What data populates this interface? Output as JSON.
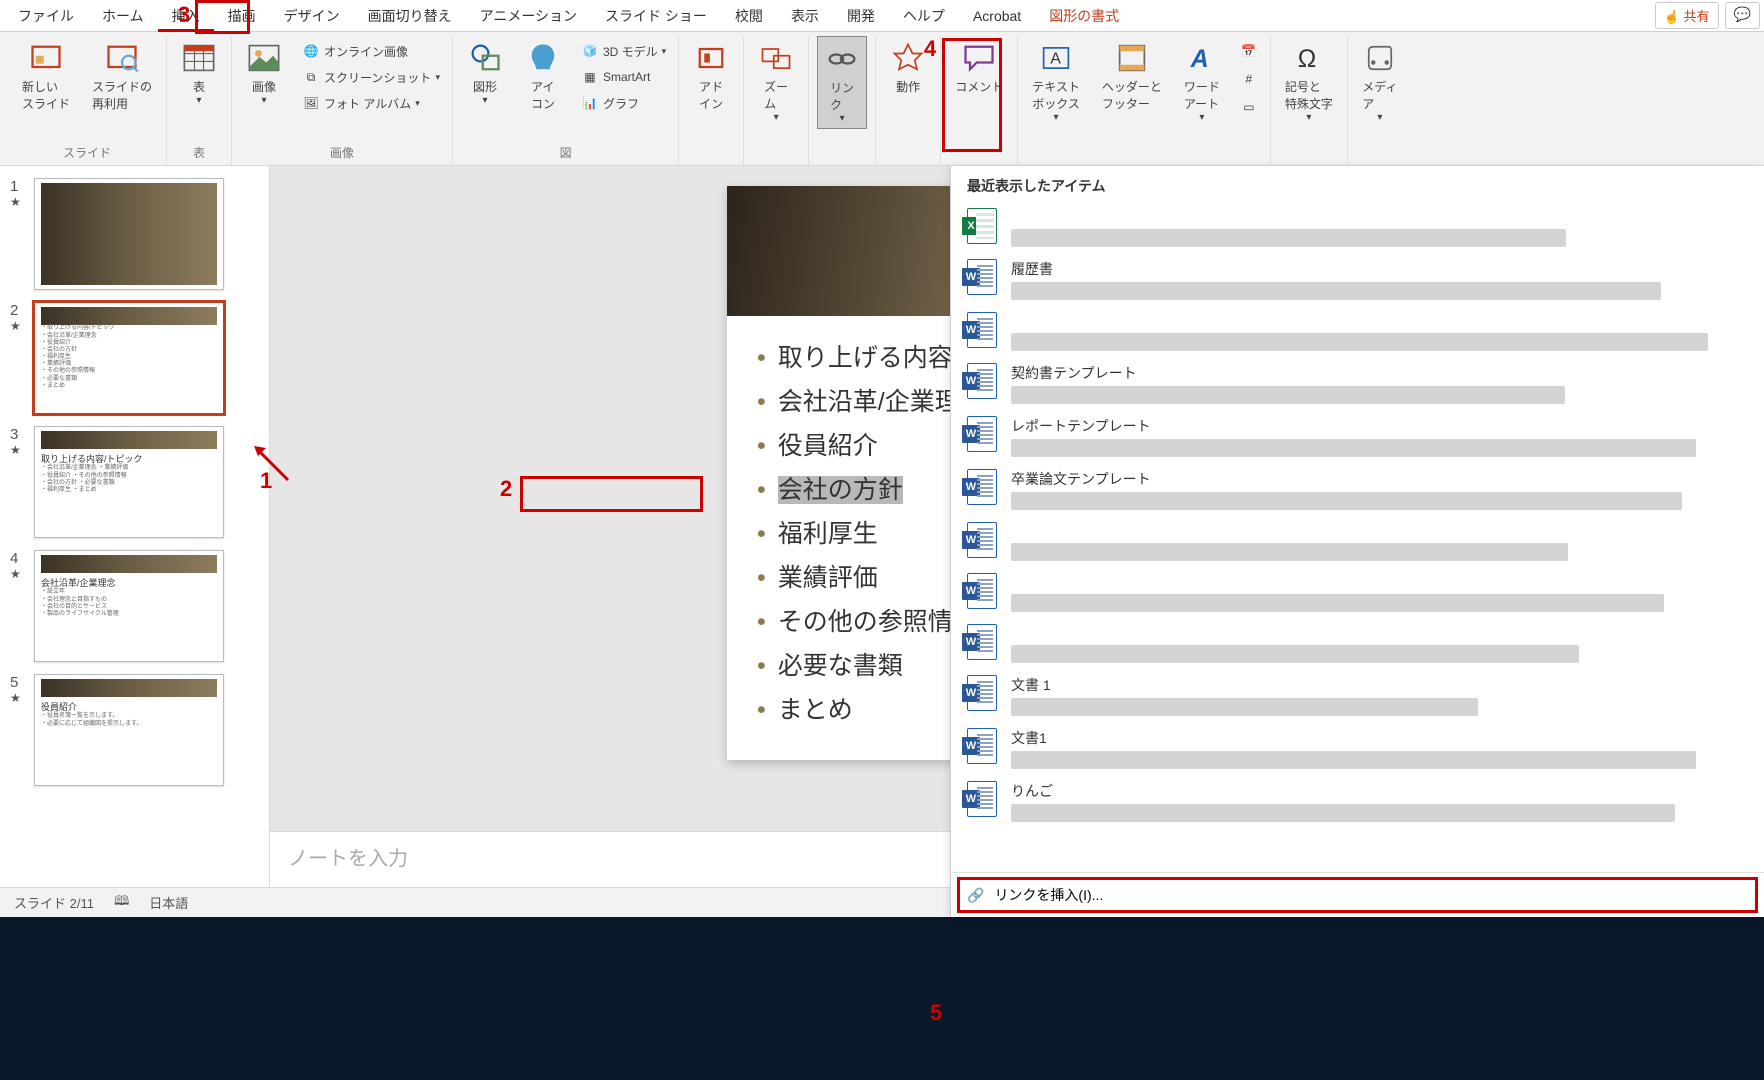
{
  "tabs": {
    "file": "ファイル",
    "home": "ホーム",
    "insert": "挿入",
    "draw": "描画",
    "design": "デザイン",
    "transition": "画面切り替え",
    "animation": "アニメーション",
    "slideshow": "スライド ショー",
    "review": "校閲",
    "view": "表示",
    "developer": "開発",
    "help": "ヘルプ",
    "acrobat": "Acrobat",
    "shapeformat": "図形の書式"
  },
  "share": {
    "label": "共有"
  },
  "ribbon": {
    "slide": {
      "new": "新しい\nスライド",
      "reuse": "スライドの\n再利用",
      "group": "スライド"
    },
    "table": {
      "btn": "表",
      "group": "表"
    },
    "images": {
      "img": "画像",
      "online": "オンライン画像",
      "screenshot": "スクリーンショット",
      "album": "フォト アルバム",
      "group": "画像"
    },
    "illus": {
      "shape": "図形",
      "icon": "アイ\nコン",
      "model": "3D モデル",
      "smartart": "SmartArt",
      "chart": "グラフ",
      "group": "図"
    },
    "addin": {
      "btn": "アド\nイン"
    },
    "zoom": {
      "btn": "ズー\nム"
    },
    "link": {
      "btn": "リン\nク"
    },
    "action": {
      "btn": "動作"
    },
    "comment": {
      "btn": "コメント"
    },
    "text": {
      "textbox": "テキスト\nボックス",
      "headerfooter": "ヘッダーと\nフッター",
      "wordart": "ワード\nアート"
    },
    "symbol": {
      "btn": "記号と\n特殊文字"
    },
    "media": {
      "btn": "メディ\nア"
    }
  },
  "slidebody": {
    "items": [
      "取り上げる内容/トピック",
      "会社沿革/企業理念",
      "役員紹介",
      "会社の方針",
      "福利厚生",
      "業績評価",
      "その他の参照情報",
      "必要な書類",
      "まとめ"
    ]
  },
  "notes": {
    "placeholder": "ノートを入力"
  },
  "status": {
    "slide": "スライド 2/11",
    "lang": "日本語"
  },
  "dropdown": {
    "head": "最近表示したアイテム",
    "items": [
      {
        "type": "excel",
        "name": ""
      },
      {
        "type": "word",
        "name": "履歴書"
      },
      {
        "type": "word",
        "name": ""
      },
      {
        "type": "word",
        "name": "契約書テンプレート"
      },
      {
        "type": "word",
        "name": "レポートテンプレート"
      },
      {
        "type": "word",
        "name": "卒業論文テンプレート"
      },
      {
        "type": "word",
        "name": ""
      },
      {
        "type": "word",
        "name": ""
      },
      {
        "type": "word",
        "name": ""
      },
      {
        "type": "word",
        "name": "文書 1"
      },
      {
        "type": "word",
        "name": "文書1"
      },
      {
        "type": "word",
        "name": "りんご"
      }
    ],
    "foot": "リンクを挿入(I)..."
  },
  "callouts": {
    "c1": "1",
    "c2": "2",
    "c3": "3",
    "c4": "4",
    "c5": "5"
  },
  "thumbs": {
    "t3title": "取り上げる内容/トピック",
    "t4title": "会社沿革/企業理念",
    "t5title": "役員紹介"
  }
}
